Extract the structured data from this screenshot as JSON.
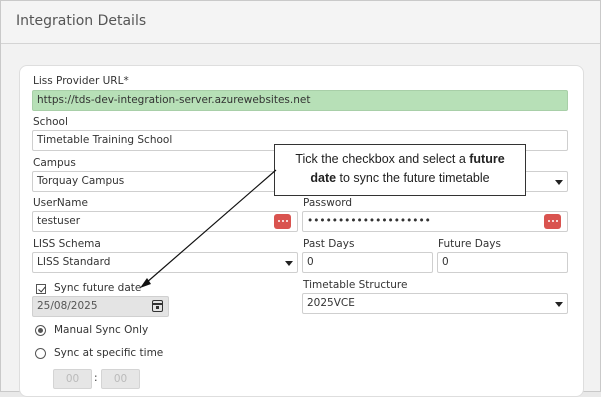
{
  "panel": {
    "title": "Integration Details"
  },
  "form": {
    "liss_url": {
      "label": "Liss Provider URL*",
      "value": "https://tds-dev-integration-server.azurewebsites.net"
    },
    "school": {
      "label": "School",
      "value": "Timetable Training School"
    },
    "campus": {
      "label": "Campus",
      "value": "Torquay Campus"
    },
    "username": {
      "label": "UserName",
      "value": "testuser"
    },
    "password": {
      "label": "Password",
      "value": "••••••••••••••••••••"
    },
    "liss_schema": {
      "label": "LISS Schema",
      "value": "LISS Standard"
    },
    "past_days": {
      "label": "Past Days",
      "value": "0"
    },
    "future_days": {
      "label": "Future Days",
      "value": "0"
    },
    "sync_future": {
      "label": "Sync future date",
      "checked": true,
      "date": "25/08/2025"
    },
    "timetable_structure": {
      "label": "Timetable Structure",
      "value": "2025VCE"
    },
    "sync_mode": {
      "manual": {
        "label": "Manual Sync Only",
        "selected": true
      },
      "specific": {
        "label": "Sync at specific time",
        "selected": false
      }
    },
    "time": {
      "hours": "00",
      "separator": ":",
      "minutes": "00"
    }
  },
  "callout": {
    "text_1": "Tick the checkbox and select a ",
    "bold_1": "future",
    "bold_2": "date",
    "text_2": " to sync the future timetable"
  },
  "colors": {
    "url_field_bg": "#b7e0b7",
    "eye_button": "#d9534f",
    "panel_bg": "#f2f2f2"
  }
}
